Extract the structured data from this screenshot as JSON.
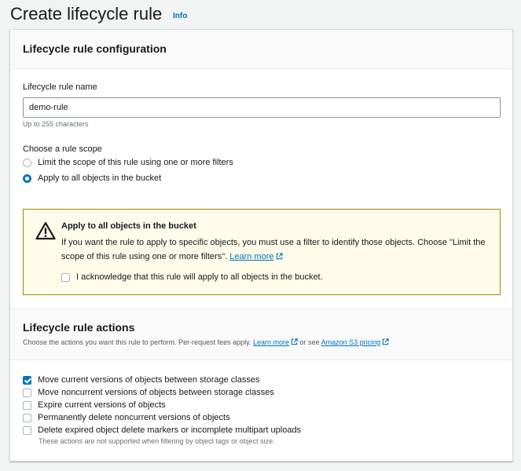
{
  "page": {
    "title": "Create lifecycle rule",
    "info_link": "Info"
  },
  "config": {
    "section_title": "Lifecycle rule configuration",
    "name_label": "Lifecycle rule name",
    "name_value": "demo-rule",
    "name_hint": "Up to 255 characters",
    "scope_label": "Choose a rule scope",
    "scope_options": [
      {
        "label": "Limit the scope of this rule using one or more filters",
        "selected": false
      },
      {
        "label": "Apply to all objects in the bucket",
        "selected": true
      }
    ],
    "warning": {
      "title": "Apply to all objects in the bucket",
      "text": "If you want the rule to apply to specific objects, you must use a filter to identify those objects. Choose \"Limit the scope of this rule using one or more filters\".",
      "link": "Learn more",
      "ack_label": "I acknowledge that this rule will apply to all objects in the bucket.",
      "ack_checked": false
    }
  },
  "actions": {
    "section_title": "Lifecycle rule actions",
    "desc_prefix": "Choose the actions you want this rule to perform. Per-request fees apply.",
    "learn_more": "Learn more",
    "desc_middle": "or see",
    "pricing_link": "Amazon S3 pricing",
    "items": [
      {
        "label": "Move current versions of objects between storage classes",
        "checked": true
      },
      {
        "label": "Move noncurrent versions of objects between storage classes",
        "checked": false
      },
      {
        "label": "Expire current versions of objects",
        "checked": false
      },
      {
        "label": "Permanently delete noncurrent versions of objects",
        "checked": false
      },
      {
        "label": "Delete expired object delete markers or incomplete multipart uploads",
        "checked": false
      }
    ],
    "note": "These actions are not supported when filtering by object tags or object size."
  },
  "colors": {
    "accent": "#0073bb",
    "warning_bg": "#fffce9",
    "warning_border": "#a58b00"
  }
}
